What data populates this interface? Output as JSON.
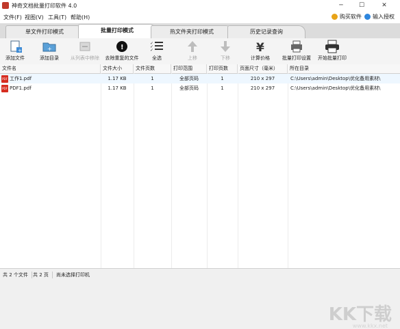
{
  "window": {
    "title": "神奇文档批量打印软件 4.0",
    "min": "─",
    "max": "☐",
    "close": "✕"
  },
  "menu": {
    "items": [
      "文件(F)",
      "视图(V)",
      "工具(T)",
      "帮助(H)"
    ],
    "buy": "购买软件",
    "register": "输入授权"
  },
  "tabs": [
    "单文件打印模式",
    "批量打印模式",
    "热文件夹打印模式",
    "历史记录查询"
  ],
  "toolbar": [
    "添加文件",
    "添加目录",
    "从列表中移除",
    "去除重复的文件",
    "全选",
    "上移",
    "下移",
    "计算价格",
    "批量打印设置",
    "开始批量打印"
  ],
  "table": {
    "headers": [
      "文件名",
      "文件大小",
      "文件页数",
      "打印范围",
      "打印页数",
      "页面尺寸（毫米）",
      "所在目录"
    ],
    "rows": [
      [
        "工作1.pdf",
        "1.17 KB",
        "1",
        "全部页码",
        "1",
        "210 x 297",
        "C:\\Users\\admin\\Desktop\\优化备用素材\\"
      ],
      [
        "PDF1.pdf",
        "1.17 KB",
        "1",
        "全部页码",
        "1",
        "210 x 297",
        "C:\\Users\\admin\\Desktop\\优化备用素材\\"
      ]
    ]
  },
  "status": [
    "共 2 个文件",
    "共 2 页",
    "尚未选择打印机"
  ],
  "watermark": {
    "logo": "KK下载",
    "url": "www.kkx.net"
  },
  "colors": {
    "accent": "#2e86de",
    "pdf": "#d62d20",
    "active_tab": "#ffffff"
  },
  "icons": [
    "add-file-icon",
    "add-folder-icon",
    "remove-icon",
    "dedupe-icon",
    "select-all-icon",
    "up-arrow-icon",
    "down-arrow-icon",
    "yen-icon",
    "printer-settings-icon",
    "printer-icon"
  ]
}
